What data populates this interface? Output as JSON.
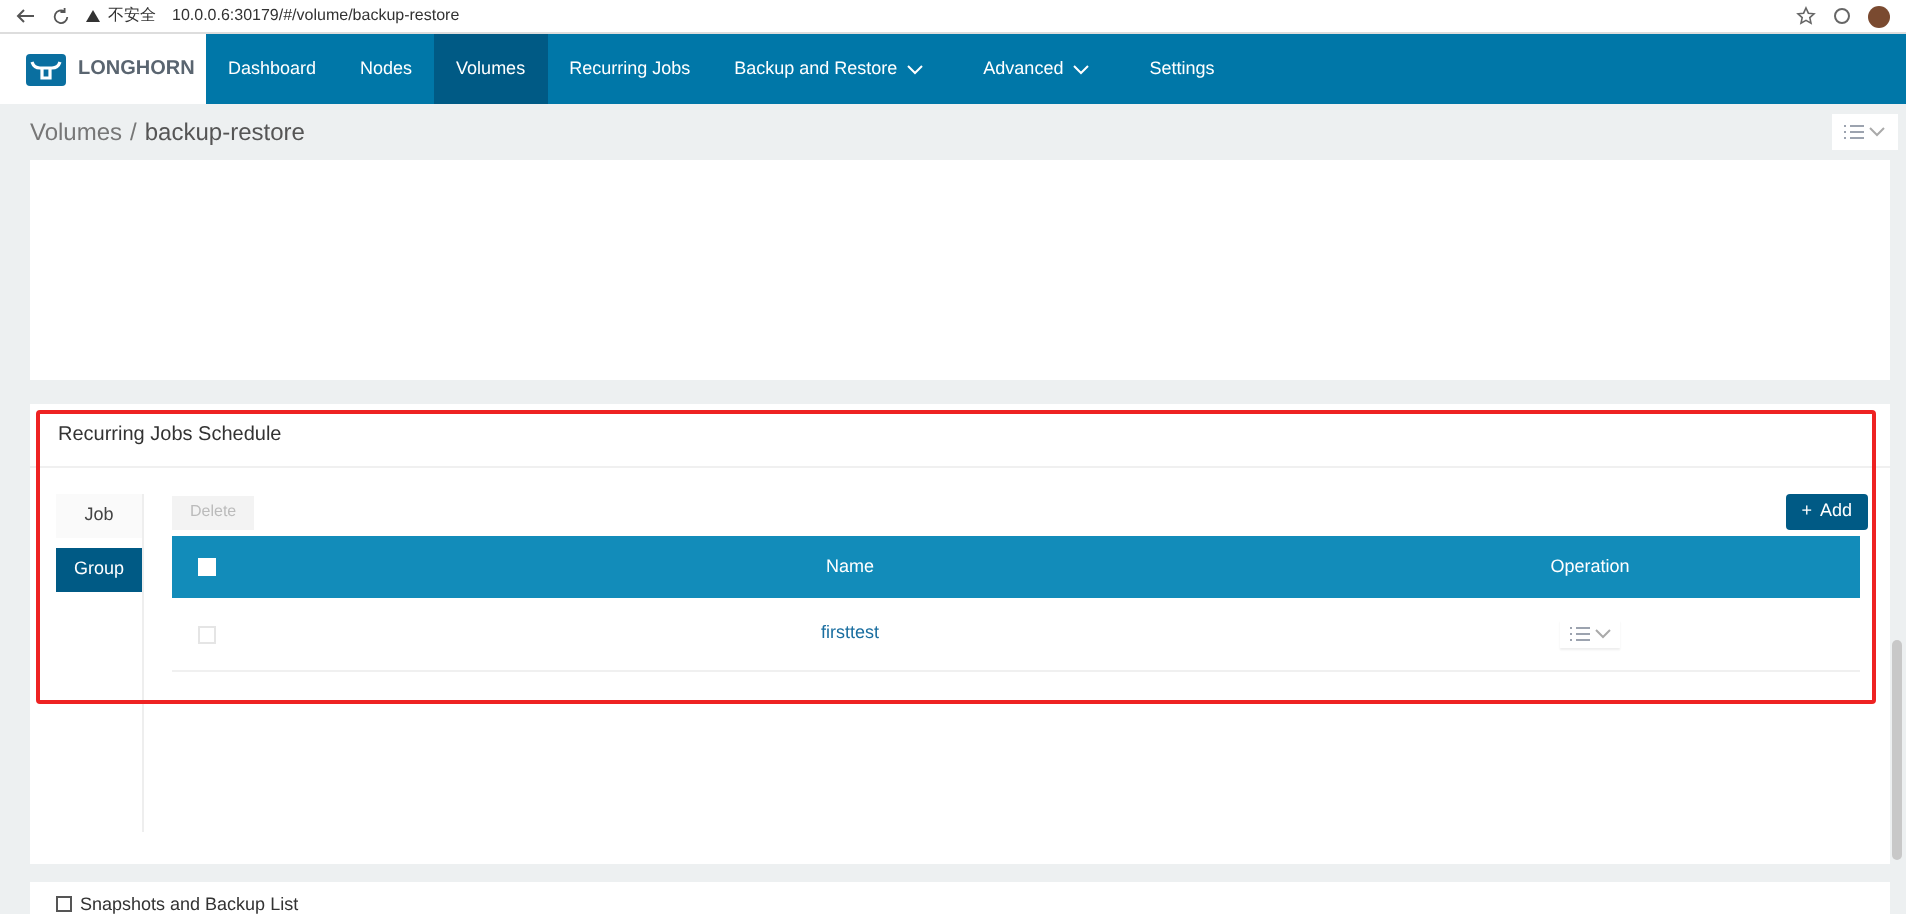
{
  "browser": {
    "security_label": "不安全",
    "url": "10.0.0.6:30179/#/volume/backup-restore"
  },
  "brand": {
    "name": "LONGHORN"
  },
  "nav": [
    {
      "label": "Dashboard",
      "selected": false,
      "dropdown": false
    },
    {
      "label": "Nodes",
      "selected": false,
      "dropdown": false
    },
    {
      "label": "Volumes",
      "selected": true,
      "dropdown": false
    },
    {
      "label": "Recurring Jobs",
      "selected": false,
      "dropdown": false
    },
    {
      "label": "Backup and Restore",
      "selected": false,
      "dropdown": true
    },
    {
      "label": "Advanced",
      "selected": false,
      "dropdown": true
    },
    {
      "label": "Settings",
      "selected": false,
      "dropdown": false
    }
  ],
  "breadcrumb": {
    "parent": "Volumes",
    "separator": "/",
    "current": "backup-restore"
  },
  "recurring_jobs": {
    "title": "Recurring Jobs Schedule",
    "tabs": [
      {
        "label": "Job",
        "selected": false
      },
      {
        "label": "Group",
        "selected": true
      }
    ],
    "delete_button": {
      "label": "Delete",
      "disabled": true
    },
    "add_button": {
      "label": "Add",
      "icon": "+"
    },
    "table": {
      "columns": [
        "Name",
        "Operation"
      ],
      "rows": [
        {
          "name": "firsttest",
          "checked": false
        }
      ],
      "header_checked": false
    }
  },
  "next_section": {
    "title": "Snapshots and Backup List",
    "checked": false
  }
}
